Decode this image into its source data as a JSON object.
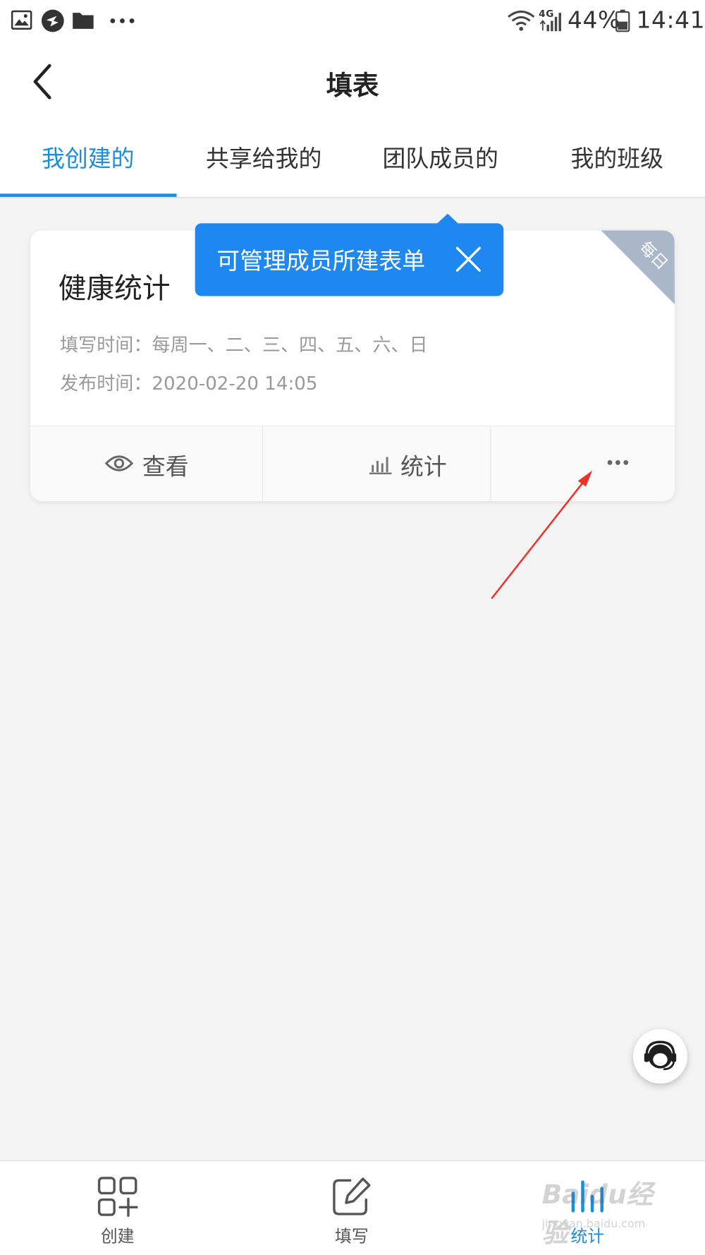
{
  "status_bar": {
    "battery": "44%",
    "time": "14:41",
    "network": "4G",
    "icons": [
      "image-icon",
      "app-bird-icon",
      "folder-icon",
      "more-dots-icon",
      "wifi-icon",
      "signal-icon",
      "battery-icon"
    ]
  },
  "header": {
    "title": "填表",
    "back_icon": "back-chevron-icon"
  },
  "tabs": [
    {
      "label": "我创建的",
      "active": true
    },
    {
      "label": "共享给我的",
      "active": false
    },
    {
      "label": "团队成员的",
      "active": false
    },
    {
      "label": "我的班级",
      "active": false
    }
  ],
  "tooltip": {
    "text": "可管理成员所建表单",
    "close_icon": "close-icon"
  },
  "card": {
    "title": "健康统计",
    "ribbon": "每日",
    "fill_time": "填写时间：每周一、二、三、四、五、六、日",
    "publish_time": "发布时间：2020-02-20 14:05",
    "actions": {
      "view": "查看",
      "stats": "统计",
      "more_icon": "more-dots-icon"
    }
  },
  "support_icon": "customer-service-icon",
  "bottom_nav": [
    {
      "label": "创建",
      "icon": "apps-add-icon",
      "active": false
    },
    {
      "label": "填写",
      "icon": "edit-icon",
      "active": false
    },
    {
      "label": "统计",
      "icon": "bar-chart-icon",
      "active": true
    }
  ],
  "watermark": {
    "brand": "Baidu经验",
    "url": "jingyan.baidu.com"
  },
  "colors": {
    "accent": "#1b8ede",
    "tooltip": "#1e88f0",
    "ribbon": "#a9b7c8",
    "annotation": "#f0302a",
    "background": "#f4f4f4"
  }
}
